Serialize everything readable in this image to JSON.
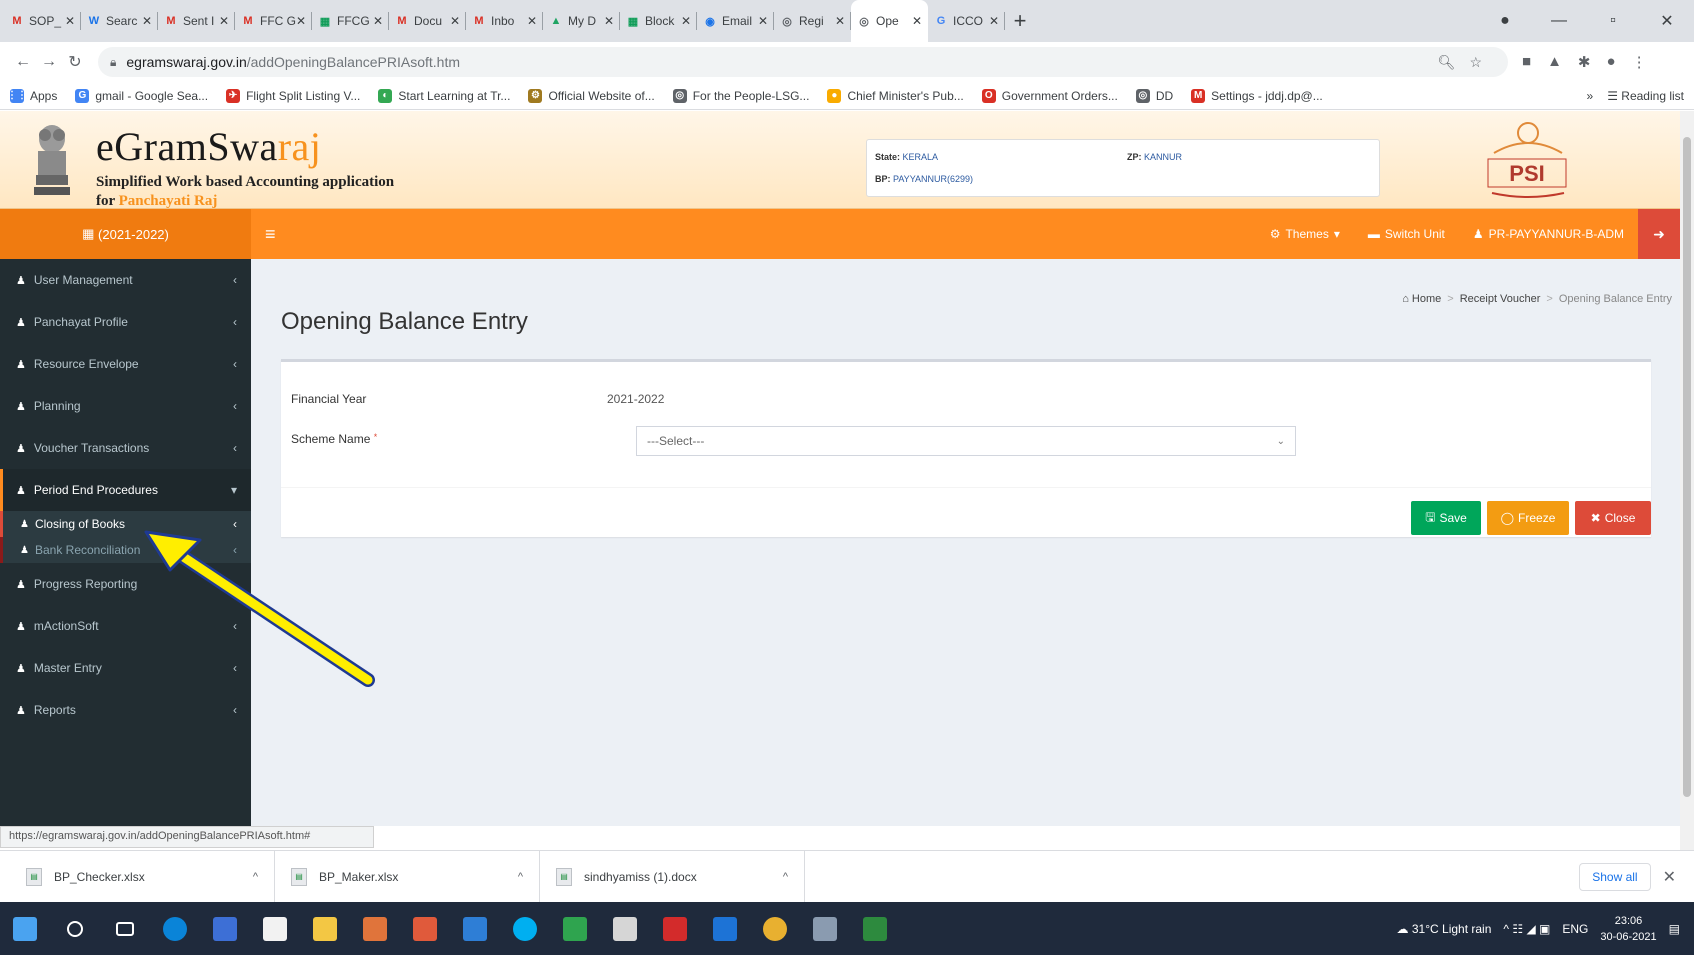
{
  "browser": {
    "tabs": [
      {
        "title": "SOP_",
        "icon": "M",
        "color": "#d93025"
      },
      {
        "title": "Searc",
        "icon": "W",
        "color": "#1a73e8"
      },
      {
        "title": "Sent I",
        "icon": "M",
        "color": "#d93025"
      },
      {
        "title": "FFC G",
        "icon": "M",
        "color": "#d93025"
      },
      {
        "title": "FFCG",
        "icon": "▦",
        "color": "#0f9d58"
      },
      {
        "title": "Docu",
        "icon": "M",
        "color": "#d93025"
      },
      {
        "title": "Inbo",
        "icon": "M",
        "color": "#d93025"
      },
      {
        "title": "My D",
        "icon": "▲",
        "color": "#1fa463"
      },
      {
        "title": "Block",
        "icon": "▦",
        "color": "#0f9d58"
      },
      {
        "title": "Email",
        "icon": "◉",
        "color": "#1a73e8"
      },
      {
        "title": "Regi",
        "icon": "◎",
        "color": "#5f6368"
      },
      {
        "title": "Ope",
        "icon": "◎",
        "color": "#5f6368",
        "active": true
      },
      {
        "title": "ICCO",
        "icon": "G",
        "color": "#4285f4"
      }
    ],
    "url_host": "egramswaraj.gov.in",
    "url_path": "/addOpeningBalancePRIAsoft.htm",
    "bookmarks": [
      {
        "label": "Apps",
        "icon": "⋮⋮",
        "color": "#4285f4"
      },
      {
        "label": "gmail - Google Sea...",
        "icon": "G",
        "color": "#4285f4"
      },
      {
        "label": "Flight Split Listing V...",
        "icon": "✈",
        "color": "#d93025"
      },
      {
        "label": "Start Learning at Tr...",
        "icon": "◐",
        "color": "#34a853"
      },
      {
        "label": "Official Website of...",
        "icon": "⚙",
        "color": "#a07a20"
      },
      {
        "label": "For the People-LSG...",
        "icon": "◎",
        "color": "#5f6368"
      },
      {
        "label": "Chief Minister's Pub...",
        "icon": "●",
        "color": "#f9ab00"
      },
      {
        "label": "Government Orders...",
        "icon": "O",
        "color": "#d93025"
      },
      {
        "label": "DD",
        "icon": "◎",
        "color": "#5f6368"
      },
      {
        "label": "Settings - jddj.dp@...",
        "icon": "M",
        "color": "#d93025"
      }
    ],
    "reading_list": "Reading list",
    "status_url": "https://egramswaraj.gov.in/addOpeningBalancePRIAsoft.htm#"
  },
  "header": {
    "title_main": "eGramSwa",
    "title_accent": "raj",
    "subtitle_line1": "Simplified Work based Accounting application",
    "subtitle_for": "for ",
    "subtitle_accent": "Panchayati Raj",
    "state_label": "State:",
    "state_value": "KERALA",
    "zp_label": "ZP:",
    "zp_value": "KANNUR",
    "bp_label": "BP:",
    "bp_value": "PAYYANNUR(6299)",
    "psi_logo": "PSI"
  },
  "topnav": {
    "year": "(2021-2022)",
    "themes": "Themes",
    "switch_unit": "Switch Unit",
    "user": "PR-PAYYANNUR-B-ADM"
  },
  "sidebar": {
    "items": [
      {
        "label": "User Management"
      },
      {
        "label": "Panchayat Profile"
      },
      {
        "label": "Resource Envelope"
      },
      {
        "label": "Planning"
      },
      {
        "label": "Voucher Transactions"
      },
      {
        "label": "Period End Procedures"
      }
    ],
    "sub_items": [
      {
        "label": "Closing of Books"
      },
      {
        "label": "Bank Reconciliation"
      }
    ],
    "items_after": [
      {
        "label": "Progress Reporting"
      },
      {
        "label": "mActionSoft"
      },
      {
        "label": "Master Entry"
      },
      {
        "label": "Reports"
      }
    ]
  },
  "main": {
    "page_title": "Opening Balance Entry",
    "breadcrumb": {
      "home": "Home",
      "section": "Receipt Voucher",
      "current": "Opening Balance Entry"
    },
    "form": {
      "financial_year_label": "Financial Year",
      "financial_year_value": "2021-2022",
      "scheme_name_label": "Scheme Name",
      "scheme_name_required": "*",
      "scheme_select_value": "---Select---"
    },
    "buttons": {
      "save": "Save",
      "freeze": "Freeze",
      "close": "Close"
    }
  },
  "downloads": [
    {
      "name": "BP_Checker.xlsx"
    },
    {
      "name": "BP_Maker.xlsx"
    },
    {
      "name": "sindhyamiss (1).docx"
    }
  ],
  "downloads_show_all": "Show all",
  "taskbar": {
    "weather": "31°C Light rain",
    "lang": "ENG",
    "time": "23:06",
    "date": "30-06-2021",
    "icons": [
      {
        "name": "windows-start",
        "color": "#4aa3f0"
      },
      {
        "name": "search",
        "color": "transparent"
      },
      {
        "name": "task-view",
        "color": "transparent"
      },
      {
        "name": "edge",
        "color": "#0a84d8"
      },
      {
        "name": "app-blue",
        "color": "#3d6fd6"
      },
      {
        "name": "store",
        "color": "#f2f2f2"
      },
      {
        "name": "file-explorer",
        "color": "#f3c744"
      },
      {
        "name": "app-orange",
        "color": "#e0743b"
      },
      {
        "name": "app-red",
        "color": "#e05a3b"
      },
      {
        "name": "app-blue2",
        "color": "#2e7ed6"
      },
      {
        "name": "skype",
        "color": "#00aff0"
      },
      {
        "name": "app-green",
        "color": "#2fa44f"
      },
      {
        "name": "app-k",
        "color": "#d6d6d6"
      },
      {
        "name": "acrobat",
        "color": "#d32b2b"
      },
      {
        "name": "mail",
        "color": "#1d73d6"
      },
      {
        "name": "chrome",
        "color": "#e8b030"
      },
      {
        "name": "app-gray",
        "color": "#8a9bb0"
      },
      {
        "name": "app-green2",
        "color": "#2d8a3e"
      }
    ]
  }
}
